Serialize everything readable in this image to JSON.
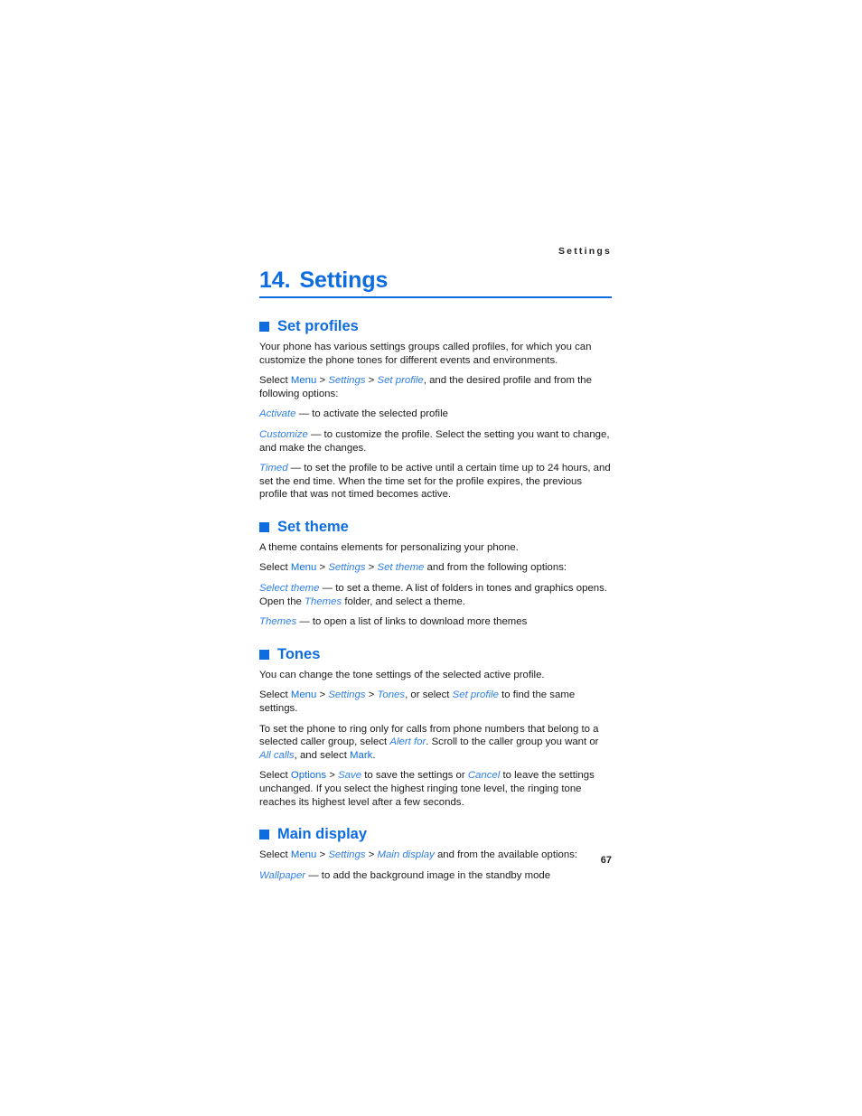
{
  "page": {
    "running_header": "Settings",
    "folio": "67",
    "accent_color": "#0d6ce0",
    "link_color": "#2f7fe8",
    "text_color": "#1a1a1a"
  },
  "chapter": {
    "number": "14.",
    "title": "Settings"
  },
  "sections": [
    {
      "id": "set-profiles",
      "heading": "Set profiles",
      "paragraphs": [
        {
          "id": "p1",
          "runs": [
            {
              "t": "Your phone has various settings groups called profiles, for which you can customize the phone tones for different events and environments.",
              "s": "plain"
            }
          ]
        },
        {
          "id": "p2",
          "runs": [
            {
              "t": "Select ",
              "s": "plain"
            },
            {
              "t": "Menu",
              "s": "ui"
            },
            {
              "t": " > ",
              "s": "sep"
            },
            {
              "t": "Settings",
              "s": "menuitem"
            },
            {
              "t": " > ",
              "s": "sep"
            },
            {
              "t": "Set profile",
              "s": "menuitem"
            },
            {
              "t": ", and the desired profile and from the following options:",
              "s": "plain"
            }
          ]
        },
        {
          "id": "p3",
          "runs": [
            {
              "t": "Activate",
              "s": "menuitem"
            },
            {
              "t": " — to activate the selected profile",
              "s": "plain"
            }
          ]
        },
        {
          "id": "p4",
          "runs": [
            {
              "t": "Customize",
              "s": "menuitem"
            },
            {
              "t": " — to customize the profile. Select the setting you want to change, and make the changes.",
              "s": "plain"
            }
          ]
        },
        {
          "id": "p5",
          "runs": [
            {
              "t": "Timed",
              "s": "menuitem"
            },
            {
              "t": " — to set the profile to be active until a certain time up to 24 hours, and set the end time. When the time set for the profile expires, the previous profile that was not timed becomes active.",
              "s": "plain"
            }
          ]
        }
      ]
    },
    {
      "id": "set-theme",
      "heading": "Set theme",
      "paragraphs": [
        {
          "id": "p1",
          "runs": [
            {
              "t": "A theme contains elements for personalizing your phone.",
              "s": "plain"
            }
          ]
        },
        {
          "id": "p2",
          "runs": [
            {
              "t": "Select ",
              "s": "plain"
            },
            {
              "t": "Menu",
              "s": "ui"
            },
            {
              "t": " > ",
              "s": "sep"
            },
            {
              "t": "Settings",
              "s": "menuitem"
            },
            {
              "t": " > ",
              "s": "sep"
            },
            {
              "t": "Set theme",
              "s": "menuitem"
            },
            {
              "t": " and from the following options:",
              "s": "plain"
            }
          ]
        },
        {
          "id": "p3",
          "runs": [
            {
              "t": "Select theme",
              "s": "menuitem"
            },
            {
              "t": " — to set a theme. A list of folders in tones and graphics opens. Open the ",
              "s": "plain"
            },
            {
              "t": "Themes",
              "s": "menuitem"
            },
            {
              "t": " folder, and select a theme.",
              "s": "plain"
            }
          ]
        },
        {
          "id": "p4",
          "runs": [
            {
              "t": "Themes",
              "s": "menuitem"
            },
            {
              "t": " — to open a list of links to download more themes",
              "s": "plain"
            }
          ]
        }
      ]
    },
    {
      "id": "tones",
      "heading": "Tones",
      "paragraphs": [
        {
          "id": "p1",
          "runs": [
            {
              "t": "You can change the tone settings of the selected active profile.",
              "s": "plain"
            }
          ]
        },
        {
          "id": "p2",
          "runs": [
            {
              "t": "Select ",
              "s": "plain"
            },
            {
              "t": "Menu",
              "s": "ui"
            },
            {
              "t": " > ",
              "s": "sep"
            },
            {
              "t": "Settings",
              "s": "menuitem"
            },
            {
              "t": " > ",
              "s": "sep"
            },
            {
              "t": "Tones",
              "s": "menuitem"
            },
            {
              "t": ", or select ",
              "s": "plain"
            },
            {
              "t": "Set profile",
              "s": "menuitem"
            },
            {
              "t": " to find the same settings.",
              "s": "plain"
            }
          ]
        },
        {
          "id": "p3",
          "runs": [
            {
              "t": "To set the phone to ring only for calls from phone numbers that belong to a selected caller group, select ",
              "s": "plain"
            },
            {
              "t": "Alert for",
              "s": "menuitem"
            },
            {
              "t": ". Scroll to the caller group you want or ",
              "s": "plain"
            },
            {
              "t": "All calls",
              "s": "menuitem"
            },
            {
              "t": ", and select ",
              "s": "plain"
            },
            {
              "t": "Mark",
              "s": "ui"
            },
            {
              "t": ".",
              "s": "plain"
            }
          ]
        },
        {
          "id": "p4",
          "runs": [
            {
              "t": "Select ",
              "s": "plain"
            },
            {
              "t": "Options",
              "s": "ui"
            },
            {
              "t": " > ",
              "s": "sep"
            },
            {
              "t": "Save",
              "s": "menuitem"
            },
            {
              "t": " to save the settings or ",
              "s": "plain"
            },
            {
              "t": "Cancel",
              "s": "menuitem"
            },
            {
              "t": " to leave the settings unchanged. If you select the highest ringing tone level, the ringing tone reaches its highest level after a few seconds.",
              "s": "plain"
            }
          ]
        }
      ]
    },
    {
      "id": "main-display",
      "heading": "Main display",
      "paragraphs": [
        {
          "id": "p1",
          "runs": [
            {
              "t": "Select ",
              "s": "plain"
            },
            {
              "t": "Menu",
              "s": "ui"
            },
            {
              "t": " > ",
              "s": "sep"
            },
            {
              "t": "Settings",
              "s": "menuitem"
            },
            {
              "t": " > ",
              "s": "sep"
            },
            {
              "t": "Main display",
              "s": "menuitem"
            },
            {
              "t": " and from the available options:",
              "s": "plain"
            }
          ]
        },
        {
          "id": "p2",
          "runs": [
            {
              "t": "Wallpaper",
              "s": "menuitem"
            },
            {
              "t": " — to add the background image in the standby mode",
              "s": "plain"
            }
          ]
        }
      ]
    }
  ]
}
